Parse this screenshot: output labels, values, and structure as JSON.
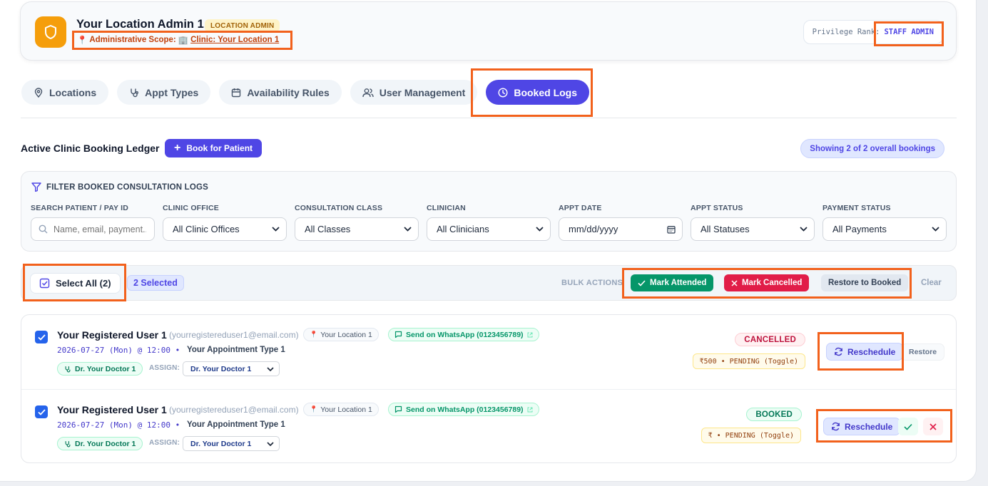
{
  "header": {
    "title": "Your Location Admin 1",
    "role_badge": "LOCATION ADMIN",
    "scope_label": "Administrative Scope:",
    "scope_link": "Clinic: Your Location 1",
    "rank_label": "Privilege Rank:",
    "rank_value": "STAFF ADMIN"
  },
  "tabs": [
    {
      "label": "Locations",
      "icon": "map-pin-icon"
    },
    {
      "label": "Appt Types",
      "icon": "stethoscope-icon"
    },
    {
      "label": "Availability Rules",
      "icon": "calendar-icon"
    },
    {
      "label": "User Management",
      "icon": "users-icon"
    },
    {
      "label": "Booked Logs",
      "icon": "clock-icon",
      "active": true
    }
  ],
  "ledger": {
    "title": "Active Clinic Booking Ledger",
    "book_button": "Book for Patient",
    "showing": "Showing 2 of 2 overall bookings"
  },
  "filters": {
    "heading": "FILTER BOOKED CONSULTATION LOGS",
    "search": {
      "label": "SEARCH PATIENT / PAY ID",
      "placeholder": "Name, email, payment..."
    },
    "office": {
      "label": "CLINIC OFFICE",
      "value": "All Clinic Offices"
    },
    "class": {
      "label": "CONSULTATION CLASS",
      "value": "All Classes"
    },
    "clinician": {
      "label": "CLINICIAN",
      "value": "All Clinicians"
    },
    "date": {
      "label": "APPT DATE",
      "value": "mm/dd/yyyy"
    },
    "status": {
      "label": "APPT STATUS",
      "value": "All Statuses"
    },
    "payment": {
      "label": "PAYMENT STATUS",
      "value": "All Payments"
    }
  },
  "bulk": {
    "select_all": "Select All (2)",
    "selected": "2 Selected",
    "label": "BULK ACTIONS",
    "attended": "Mark Attended",
    "cancelled": "Mark Cancelled",
    "restore": "Restore to Booked",
    "clear": "Clear"
  },
  "bookings": [
    {
      "name": "Your Registered User 1",
      "email": "(yourregistereduser1@email.com)",
      "location": "Your Location 1",
      "whatsapp": "Send on WhatsApp (0123456789)",
      "datetime": "2026-07-27 (Mon) @ 12:00 •",
      "appt_type": "Your Appointment Type 1",
      "doctor": "Dr. Your Doctor 1",
      "assign_label": "ASSIGN:",
      "assign_value": "Dr. Your Doctor 1",
      "status": "CANCELLED",
      "payment": "₹500 • PENDING (Toggle)",
      "reschedule": "Reschedule",
      "restore": "Restore"
    },
    {
      "name": "Your Registered User 1",
      "email": "(yourregistereduser1@email.com)",
      "location": "Your Location 1",
      "whatsapp": "Send on WhatsApp (0123456789)",
      "datetime": "2026-07-27 (Mon) @ 12:00 •",
      "appt_type": "Your Appointment Type 1",
      "doctor": "Dr. Your Doctor 1",
      "assign_label": "ASSIGN:",
      "assign_value": "Dr. Your Doctor 1",
      "status": "BOOKED",
      "payment": "₹ • PENDING (Toggle)",
      "reschedule": "Reschedule"
    }
  ],
  "colors": {
    "accent": "#4f46e5",
    "highlight": "#f2611c",
    "success": "#059669",
    "danger": "#e11d48",
    "warning": "#f59e0b"
  }
}
